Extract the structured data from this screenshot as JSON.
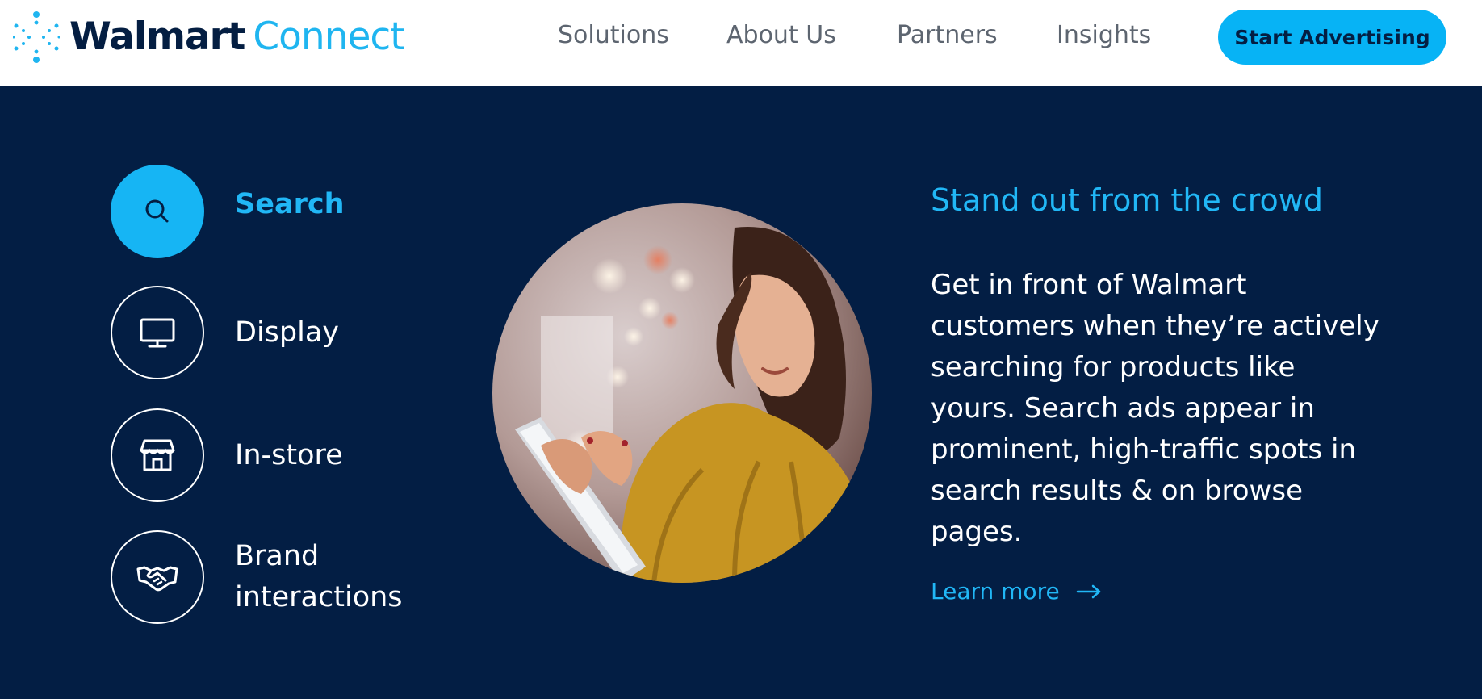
{
  "header": {
    "logo": {
      "brand": "Walmart",
      "product": "Connect",
      "icon": "spark-dots-logo-icon"
    },
    "nav": [
      {
        "label": "Solutions"
      },
      {
        "label": "About Us"
      },
      {
        "label": "Partners"
      },
      {
        "label": "Insights"
      }
    ],
    "cta_label": "Start Advertising"
  },
  "solutions": {
    "tabs": [
      {
        "label": "Search",
        "icon": "search-icon",
        "active": true
      },
      {
        "label": "Display",
        "icon": "monitor-icon",
        "active": false
      },
      {
        "label": "In-store",
        "icon": "storefront-icon",
        "active": false
      },
      {
        "label": "Brand interactions",
        "icon": "handshake-icon",
        "active": false
      }
    ],
    "content": {
      "headline": "Stand out from the crowd",
      "body": "Get in front of Walmart customers when they’re actively searching for products like yours. Search ads appear in prominent, high-traffic spots in search results & on browse pages.",
      "learn_more": "Learn more",
      "link_icon": "arrow-right-icon"
    }
  },
  "colors": {
    "navy": "#031e44",
    "accent_blue": "#21b7f6",
    "brand_navy_text": "#041e42",
    "nav_gray": "#5d6570",
    "white": "#ffffff"
  }
}
